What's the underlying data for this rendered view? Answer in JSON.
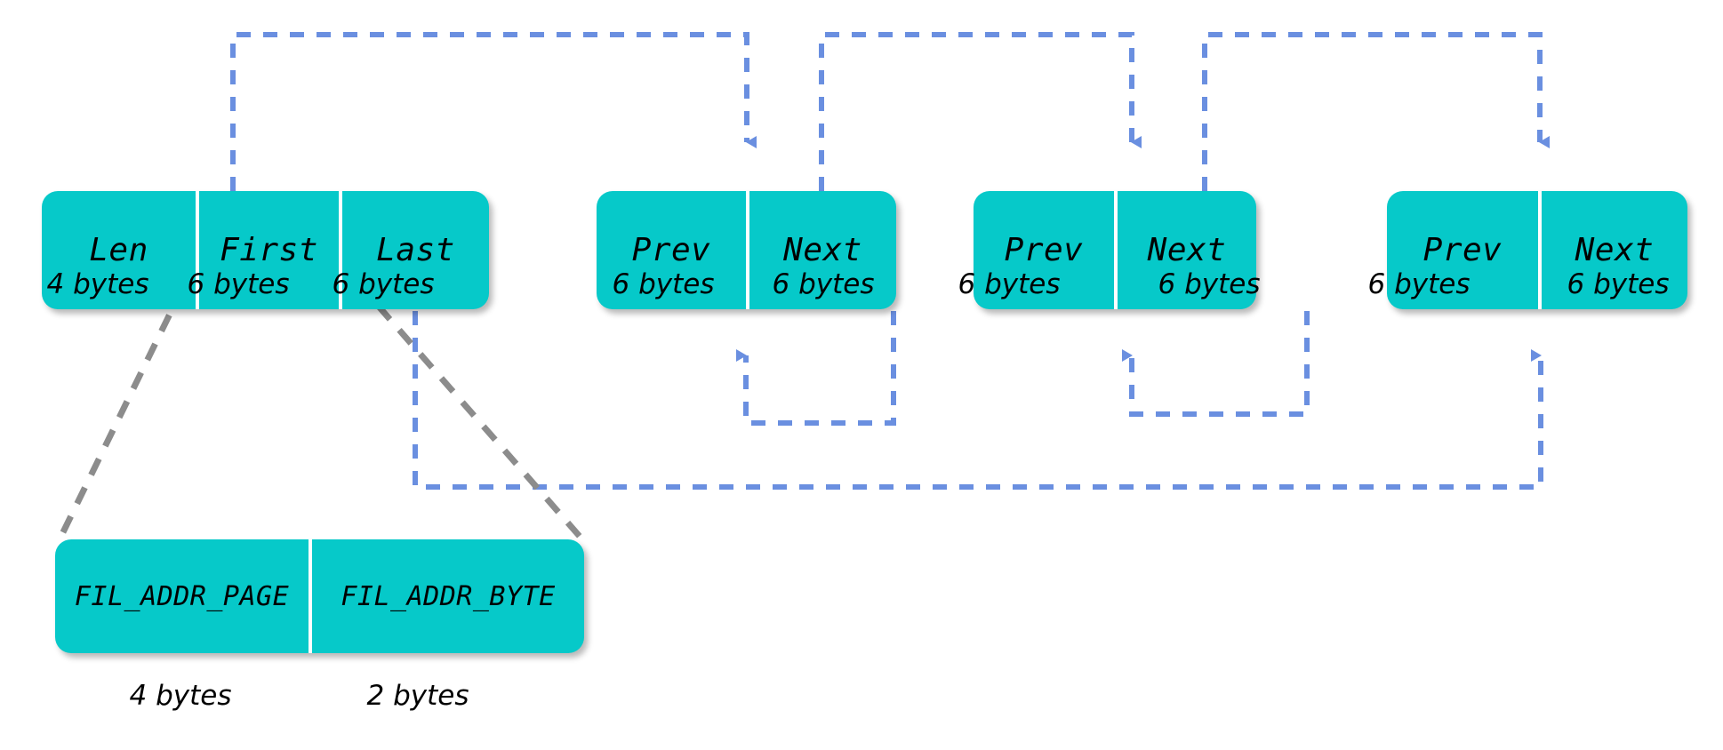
{
  "diagram": {
    "title": "InnoDB FIL list / list node layout",
    "colors": {
      "node_fill": "#06C9C9",
      "divider": "#ffffff",
      "pointer_edge": "#6A8FE0",
      "leader_line": "#8C8C8C",
      "text": "#000000",
      "background": "#ffffff"
    },
    "base_node": {
      "name": "list-base-node",
      "cells": [
        {
          "label": "Len",
          "size": "4 bytes"
        },
        {
          "label": "First",
          "size": "6 bytes"
        },
        {
          "label": "Last",
          "size": "6 bytes"
        }
      ]
    },
    "list_nodes": [
      {
        "name": "list-node-1",
        "cells": [
          {
            "label": "Prev",
            "size": "6 bytes"
          },
          {
            "label": "Next",
            "size": "6 bytes"
          }
        ]
      },
      {
        "name": "list-node-2",
        "cells": [
          {
            "label": "Prev",
            "size": "6 bytes"
          },
          {
            "label": "Next",
            "size": "6 bytes"
          }
        ]
      },
      {
        "name": "list-node-3",
        "cells": [
          {
            "label": "Prev",
            "size": "6 bytes"
          },
          {
            "label": "Next",
            "size": "6 bytes"
          }
        ]
      }
    ],
    "address_node": {
      "name": "fil-addr-node",
      "cells": [
        {
          "label": "FIL_ADDR_PAGE",
          "size": "4 bytes"
        },
        {
          "label": "FIL_ADDR_BYTE",
          "size": "2 bytes"
        }
      ]
    }
  }
}
